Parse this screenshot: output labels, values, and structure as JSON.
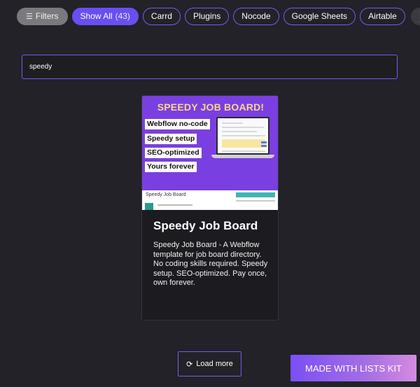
{
  "filters": {
    "filters_label": "Filters",
    "chips": [
      {
        "label": "Show All",
        "count": "(43)"
      },
      {
        "label": "Carrd"
      },
      {
        "label": "Plugins"
      },
      {
        "label": "Nocode"
      },
      {
        "label": "Google Sheets"
      },
      {
        "label": "Airtable"
      }
    ],
    "next_arrow": "❯"
  },
  "search": {
    "value": "speedy"
  },
  "card": {
    "thumb": {
      "headline": "SPEEDY JOB BOARD!",
      "tags": [
        "Webflow no-code",
        "Speedy setup",
        "SEO-optimized",
        "Yours forever"
      ],
      "sub_label": "Speedy Job Board"
    },
    "title": "Speedy Job Board",
    "description": "Speedy Job Board - A Webflow template for job board directory. No coding skills required. Speedy setup. SEO-optimized. Pay once, own forever."
  },
  "load_more": {
    "label": "Load more",
    "icon": "refresh-icon"
  },
  "badge": {
    "label": "MADE WITH LISTS KIT"
  },
  "colors": {
    "background": "#222228",
    "accent": "#6a4ef2",
    "card_bg": "#1c1c20"
  }
}
